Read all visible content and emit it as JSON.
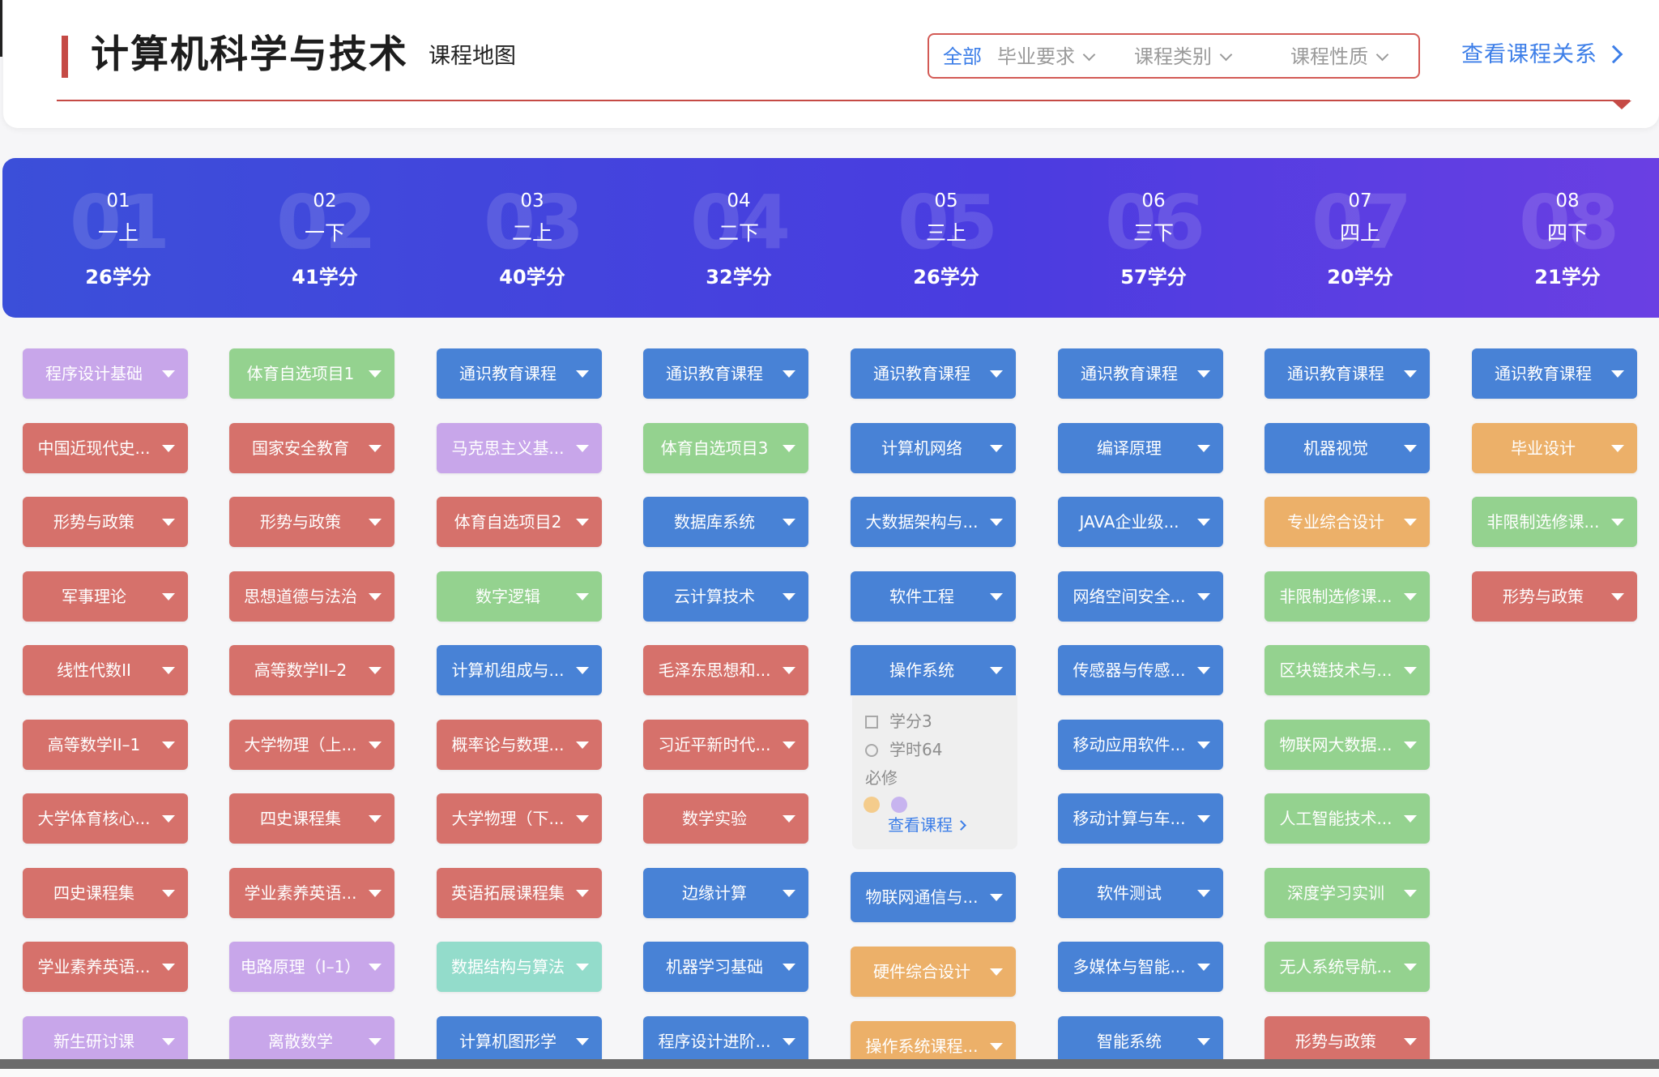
{
  "header": {
    "title": "计算机科学与技术",
    "subtitle": "课程地图",
    "filters": [
      {
        "label": "全部",
        "active": true,
        "dropdown": false
      },
      {
        "label": "毕业要求",
        "active": false,
        "dropdown": true
      },
      {
        "label": "课程类别",
        "active": false,
        "dropdown": true
      },
      {
        "label": "课程性质",
        "active": false,
        "dropdown": true
      }
    ],
    "relation_link": "查看课程关系"
  },
  "semesters": [
    {
      "num": "01",
      "name": "一上",
      "credits": "26学分"
    },
    {
      "num": "02",
      "name": "一下",
      "credits": "41学分"
    },
    {
      "num": "03",
      "name": "二上",
      "credits": "40学分"
    },
    {
      "num": "04",
      "name": "二下",
      "credits": "32学分"
    },
    {
      "num": "05",
      "name": "三上",
      "credits": "26学分"
    },
    {
      "num": "06",
      "name": "三下",
      "credits": "57学分"
    },
    {
      "num": "07",
      "name": "四上",
      "credits": "20学分"
    },
    {
      "num": "08",
      "name": "四下",
      "credits": "21学分"
    }
  ],
  "colors": {
    "blue": "#4882d6",
    "red": "#d6716b",
    "green": "#94d28f",
    "purple": "#c8a6ea",
    "orange": "#ecb069",
    "teal": "#93dccb",
    "accent": "#c54a45",
    "link": "#3c7ee8"
  },
  "columns": [
    [
      {
        "label": "程序设计基础",
        "color": "purple"
      },
      {
        "label": "中国近现代史...",
        "color": "red"
      },
      {
        "label": "形势与政策",
        "color": "red"
      },
      {
        "label": "军事理论",
        "color": "red"
      },
      {
        "label": "线性代数II",
        "color": "red"
      },
      {
        "label": "高等数学II–1",
        "color": "red"
      },
      {
        "label": "大学体育核心...",
        "color": "red"
      },
      {
        "label": "四史课程集",
        "color": "red"
      },
      {
        "label": "学业素养英语...",
        "color": "red"
      },
      {
        "label": "新生研讨课",
        "color": "purple"
      }
    ],
    [
      {
        "label": "体育自选项目1",
        "color": "green"
      },
      {
        "label": "国家安全教育",
        "color": "red"
      },
      {
        "label": "形势与政策",
        "color": "red"
      },
      {
        "label": "思想道德与法治",
        "color": "red"
      },
      {
        "label": "高等数学II–2",
        "color": "red"
      },
      {
        "label": "大学物理（上...",
        "color": "red"
      },
      {
        "label": "四史课程集",
        "color": "red"
      },
      {
        "label": "学业素养英语...",
        "color": "red"
      },
      {
        "label": "电路原理（I–1）",
        "color": "purple"
      },
      {
        "label": "离散数学",
        "color": "purple"
      }
    ],
    [
      {
        "label": "通识教育课程",
        "color": "blue"
      },
      {
        "label": "马克思主义基...",
        "color": "purple"
      },
      {
        "label": "体育自选项目2",
        "color": "red"
      },
      {
        "label": "数字逻辑",
        "color": "green"
      },
      {
        "label": "计算机组成与...",
        "color": "blue"
      },
      {
        "label": "概率论与数理...",
        "color": "red"
      },
      {
        "label": "大学物理（下...",
        "color": "red"
      },
      {
        "label": "英语拓展课程集",
        "color": "red"
      },
      {
        "label": "数据结构与算法",
        "color": "teal"
      },
      {
        "label": "计算机图形学",
        "color": "blue"
      }
    ],
    [
      {
        "label": "通识教育课程",
        "color": "blue"
      },
      {
        "label": "体育自选项目3",
        "color": "green"
      },
      {
        "label": "数据库系统",
        "color": "blue"
      },
      {
        "label": "云计算技术",
        "color": "blue"
      },
      {
        "label": "毛泽东思想和...",
        "color": "red"
      },
      {
        "label": "习近平新时代...",
        "color": "red"
      },
      {
        "label": "数学实验",
        "color": "red"
      },
      {
        "label": "边缘计算",
        "color": "blue"
      },
      {
        "label": "机器学习基础",
        "color": "blue"
      },
      {
        "label": "程序设计进阶...",
        "color": "blue"
      }
    ],
    [
      {
        "label": "通识教育课程",
        "color": "blue"
      },
      {
        "label": "计算机网络",
        "color": "blue"
      },
      {
        "label": "大数据架构与...",
        "color": "blue"
      },
      {
        "label": "软件工程",
        "color": "blue"
      },
      {
        "label": "操作系统",
        "color": "blue"
      },
      {
        "label": "物联网通信与...",
        "color": "blue"
      },
      {
        "label": "硬件综合设计",
        "color": "orange"
      },
      {
        "label": "操作系统课程...",
        "color": "orange"
      }
    ],
    [
      {
        "label": "通识教育课程",
        "color": "blue"
      },
      {
        "label": "编译原理",
        "color": "blue"
      },
      {
        "label": "JAVA企业级...",
        "color": "blue"
      },
      {
        "label": "网络空间安全...",
        "color": "blue"
      },
      {
        "label": "传感器与传感...",
        "color": "blue"
      },
      {
        "label": "移动应用软件...",
        "color": "blue"
      },
      {
        "label": "移动计算与车...",
        "color": "blue"
      },
      {
        "label": "软件测试",
        "color": "blue"
      },
      {
        "label": "多媒体与智能...",
        "color": "blue"
      },
      {
        "label": "智能系统",
        "color": "blue"
      }
    ],
    [
      {
        "label": "通识教育课程",
        "color": "blue"
      },
      {
        "label": "机器视觉",
        "color": "blue"
      },
      {
        "label": "专业综合设计",
        "color": "orange"
      },
      {
        "label": "非限制选修课...",
        "color": "green"
      },
      {
        "label": "区块链技术与...",
        "color": "green"
      },
      {
        "label": "物联网大数据...",
        "color": "green"
      },
      {
        "label": "人工智能技术...",
        "color": "green"
      },
      {
        "label": "深度学习实训",
        "color": "green"
      },
      {
        "label": "无人系统导航...",
        "color": "green"
      },
      {
        "label": "形势与政策",
        "color": "red"
      }
    ],
    [
      {
        "label": "通识教育课程",
        "color": "blue"
      },
      {
        "label": "毕业设计",
        "color": "orange"
      },
      {
        "label": "非限制选修课...",
        "color": "green"
      },
      {
        "label": "形势与政策",
        "color": "red"
      }
    ]
  ],
  "popup": {
    "credits": "学分3",
    "hours": "学时64",
    "type": "必修",
    "dot_colors": [
      "#f4cc8c",
      "#c7b4ef"
    ],
    "link": "查看课程"
  }
}
